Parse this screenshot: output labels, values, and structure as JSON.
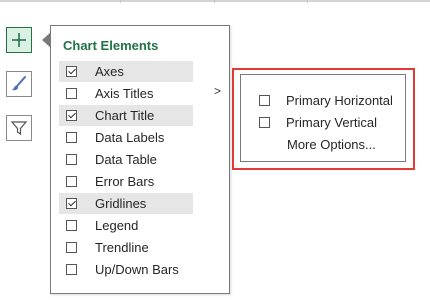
{
  "panel": {
    "title": "Chart Elements",
    "items": [
      {
        "label": "Axes",
        "checked": true
      },
      {
        "label": "Axis Titles",
        "checked": false
      },
      {
        "label": "Chart Title",
        "checked": true
      },
      {
        "label": "Data Labels",
        "checked": false
      },
      {
        "label": "Data Table",
        "checked": false
      },
      {
        "label": "Error Bars",
        "checked": false
      },
      {
        "label": "Gridlines",
        "checked": true
      },
      {
        "label": "Legend",
        "checked": false
      },
      {
        "label": "Trendline",
        "checked": false
      },
      {
        "label": "Up/Down Bars",
        "checked": false
      }
    ],
    "expand_arrow": ">"
  },
  "submenu": {
    "items": [
      {
        "label": "Primary Horizontal",
        "checked": false
      },
      {
        "label": "Primary Vertical",
        "checked": false
      }
    ],
    "more_label": "More Options..."
  },
  "side_buttons": [
    {
      "icon": "plus-icon",
      "active": true
    },
    {
      "icon": "brush-icon",
      "active": false
    },
    {
      "icon": "filter-icon",
      "active": false
    }
  ],
  "colors": {
    "accent": "#217346",
    "highlight_box": "#e53935"
  }
}
